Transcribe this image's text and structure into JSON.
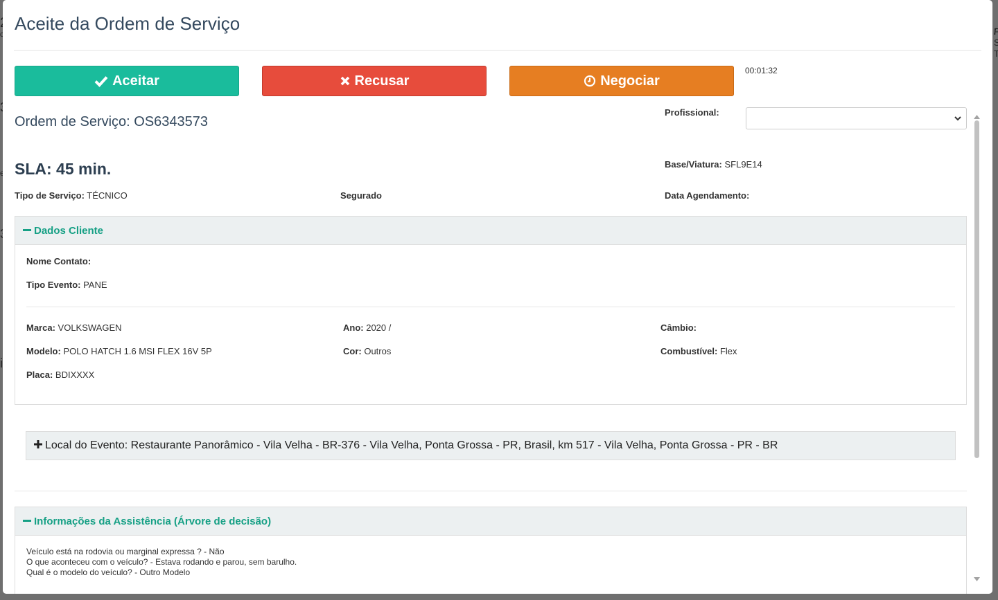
{
  "background": {
    "fragments": [
      "2",
      "c",
      "/",
      "F",
      "S",
      "T",
      "3",
      "e",
      "3",
      "i",
      "e",
      "e",
      "3",
      "i"
    ]
  },
  "modal": {
    "title": "Aceite da Ordem de Serviço",
    "buttons": {
      "accept": "Aceitar",
      "refuse": "Recusar",
      "negotiate": "Negociar"
    },
    "timer": "00:01:32",
    "os_label": "Ordem de Serviço: OS6343573",
    "sla": "SLA: 45 min.",
    "profissional": {
      "label": "Profissional:",
      "value": ""
    },
    "base_viatura": {
      "label": "Base/Viatura:",
      "value": " SFL9E14"
    },
    "tipo_servico": {
      "label": "Tipo de Serviço:",
      "value": " TÉCNICO"
    },
    "segurado": {
      "label": "Segurado",
      "value": ""
    },
    "data_agendamento": {
      "label": "Data Agendamento:",
      "value": ""
    }
  },
  "dados_cliente": {
    "title": "Dados Cliente",
    "nome_contato": {
      "label": "Nome Contato:",
      "value": ""
    },
    "tipo_evento": {
      "label": "Tipo Evento:",
      "value": " PANE"
    },
    "marca": {
      "label": "Marca:",
      "value": " VOLKSWAGEN"
    },
    "ano": {
      "label": "Ano:",
      "value": " 2020 /"
    },
    "cambio": {
      "label": "Câmbio:",
      "value": ""
    },
    "modelo": {
      "label": "Modelo:",
      "value": " POLO HATCH 1.6 MSI FLEX 16V 5P"
    },
    "cor": {
      "label": "Cor:",
      "value": " Outros"
    },
    "combustivel": {
      "label": "Combustível:",
      "value": " Flex"
    },
    "placa": {
      "label": "Placa:",
      "value": " BDIXXXX"
    }
  },
  "local_evento": {
    "text": "Local do Evento: Restaurante Panorâmico - Vila Velha - BR-376 - Vila Velha, Ponta Grossa - PR, Brasil, km 517 - Vila Velha, Ponta Grossa - PR - BR"
  },
  "assistencia": {
    "title": "Informações da Assistência (Árvore de decisão)",
    "lines": [
      "Veículo está na rodovia ou marginal expressa ? - Não",
      "O que aconteceu com o veículo? - Estava rodando e parou, sem barulho.",
      "Qual é o modelo do veículo? - Outro Modelo"
    ]
  },
  "colors": {
    "accept": "#1abc9c",
    "refuse": "#e74c3c",
    "negotiate": "#e67e22",
    "panel_title": "#16a085"
  },
  "icons": {
    "accept": "check-icon",
    "refuse": "times-icon",
    "negotiate": "clock-icon",
    "collapse": "minus-icon",
    "expand": "plus-icon",
    "select": "chevron-down-icon"
  }
}
